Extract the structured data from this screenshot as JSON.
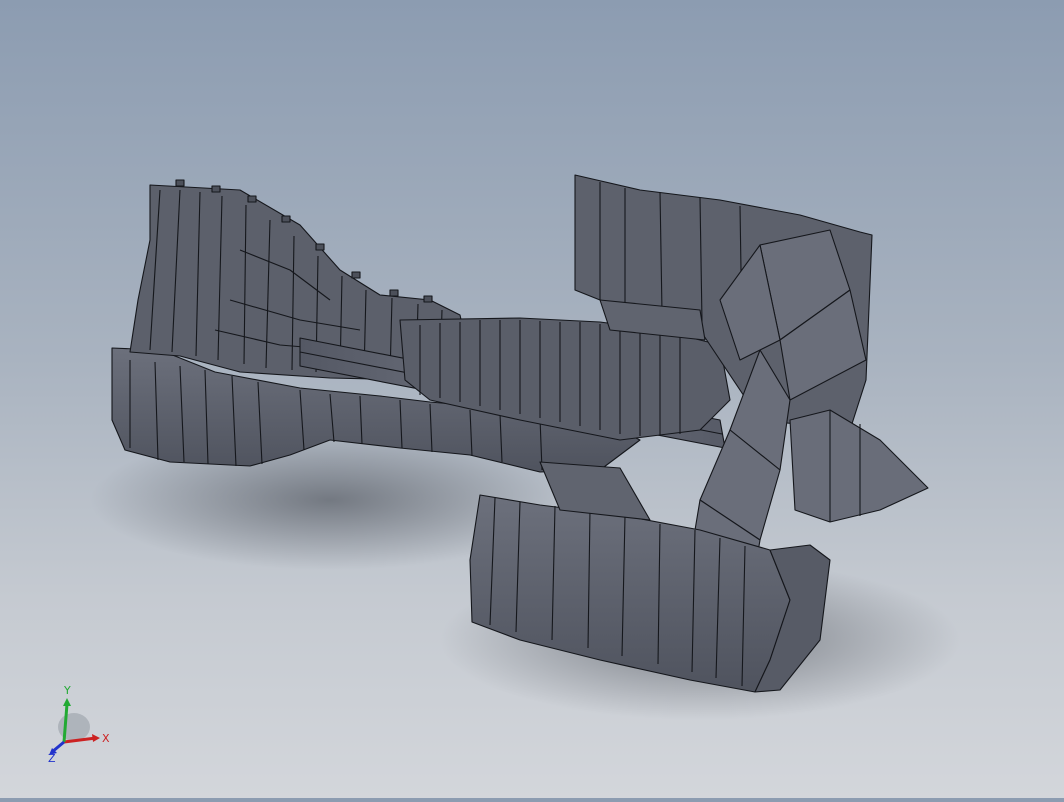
{
  "viewport": {
    "background_top": "#8c9cb1",
    "background_bottom": "#d3d6db",
    "model_color": "#5f636f",
    "edge_color": "#15171c",
    "subject": "turbofan-engine-section-view"
  },
  "triad": {
    "x_label": "X",
    "y_label": "Y",
    "z_label": "Z",
    "x_color": "#cc2222",
    "y_color": "#22aa33",
    "z_color": "#2233cc"
  }
}
